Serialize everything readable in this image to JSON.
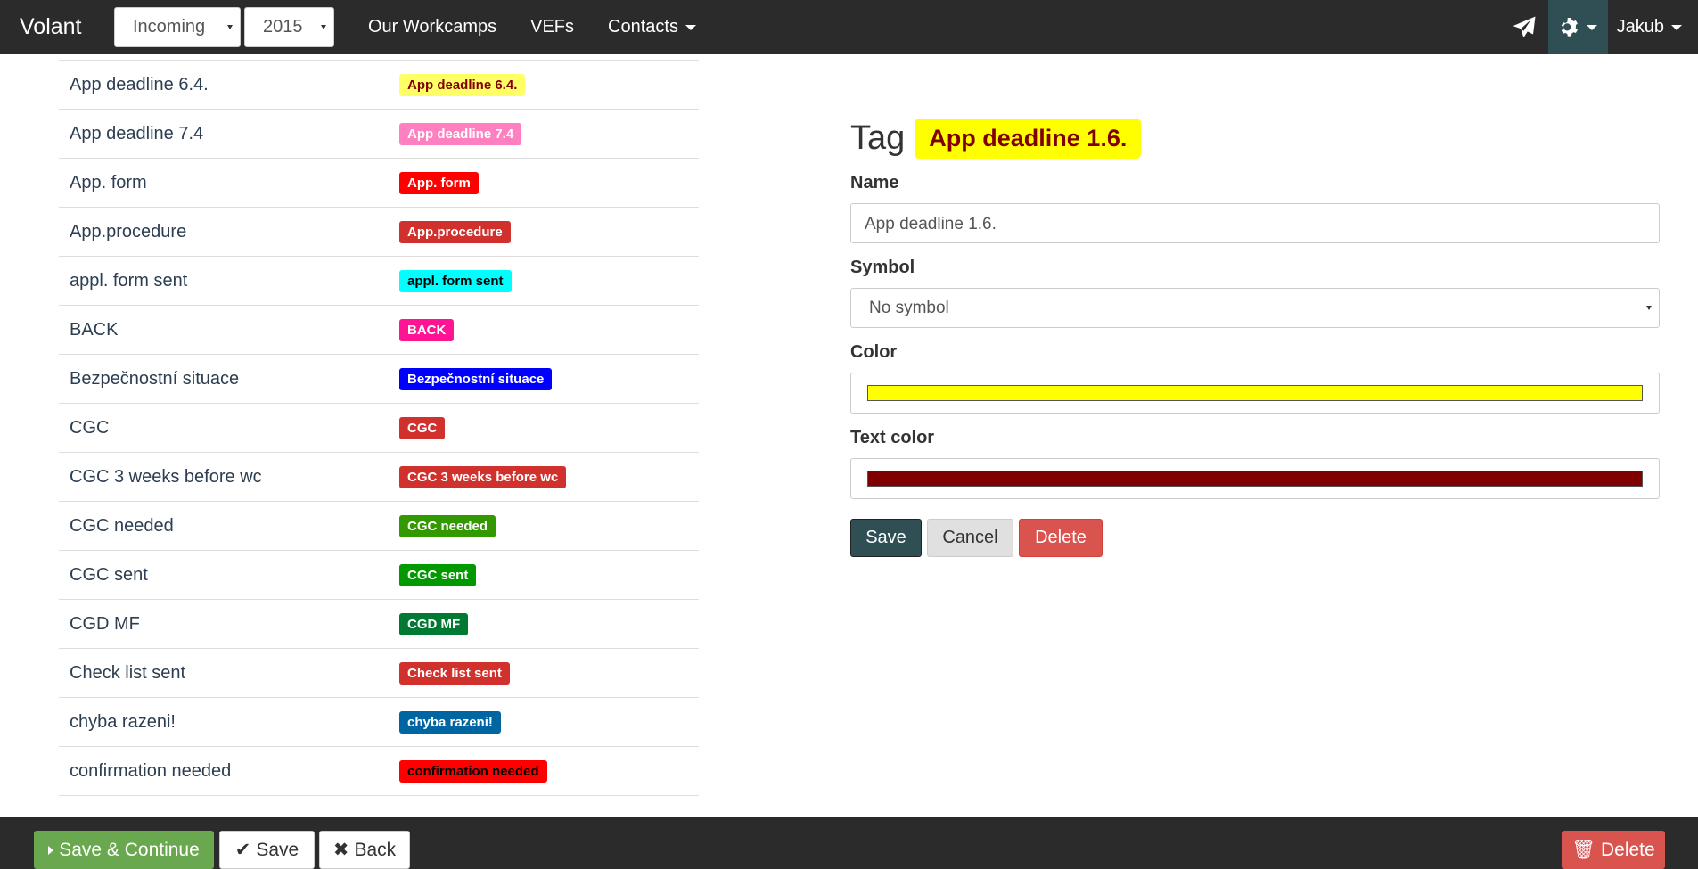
{
  "navbar": {
    "brand": "Volant",
    "direction_select": "Incoming",
    "year_select": "2015",
    "links": [
      "Our Workcamps",
      "VEFs",
      "Contacts"
    ],
    "user": "Jakub"
  },
  "tags": [
    {
      "name": "App deadline 6.4.",
      "badge": "App deadline 6.4.",
      "bg": "#ffff66",
      "fg": "#800000"
    },
    {
      "name": "App deadline 7.4",
      "badge": "App deadline 7.4",
      "bg": "#ff80c0",
      "fg": "#ffffff"
    },
    {
      "name": "App. form",
      "badge": "App. form",
      "bg": "#ff0000",
      "fg": "#ffffff"
    },
    {
      "name": "App.procedure",
      "badge": "App.procedure",
      "bg": "#d0312d",
      "fg": "#ffffff"
    },
    {
      "name": "appl. form sent",
      "badge": "appl. form sent",
      "bg": "#00ffff",
      "fg": "#000000"
    },
    {
      "name": "BACK",
      "badge": "BACK",
      "bg": "#ff1493",
      "fg": "#ffffff"
    },
    {
      "name": "Bezpečnostní situace",
      "badge": "Bezpečnostní situace",
      "bg": "#0000ff",
      "fg": "#ffffff"
    },
    {
      "name": "CGC",
      "badge": "CGC",
      "bg": "#d0312d",
      "fg": "#ffffff"
    },
    {
      "name": "CGC 3 weeks before wc",
      "badge": "CGC 3 weeks before wc",
      "bg": "#d0312d",
      "fg": "#ffffff"
    },
    {
      "name": "CGC needed",
      "badge": "CGC needed",
      "bg": "#339900",
      "fg": "#ffffff"
    },
    {
      "name": "CGC sent",
      "badge": "CGC sent",
      "bg": "#009900",
      "fg": "#ffffff"
    },
    {
      "name": "CGD MF",
      "badge": "CGD MF",
      "bg": "#007a33",
      "fg": "#ffffff"
    },
    {
      "name": "Check list sent",
      "badge": "Check list sent",
      "bg": "#d0312d",
      "fg": "#ffffff"
    },
    {
      "name": "chyba razeni!",
      "badge": "chyba razeni!",
      "bg": "#0066a1",
      "fg": "#ffffff"
    },
    {
      "name": "confirmation needed",
      "badge": "confirmation needed",
      "bg": "#ff0000",
      "fg": "#000000"
    }
  ],
  "form": {
    "title": "Tag",
    "preview": "App deadline 1.6.",
    "name_label": "Name",
    "name_value": "App deadline 1.6.",
    "symbol_label": "Symbol",
    "symbol_value": "No symbol",
    "color_label": "Color",
    "color_value": "#ffff00",
    "text_color_label": "Text color",
    "text_color_value": "#800000",
    "save": "Save",
    "cancel": "Cancel",
    "delete": "Delete"
  },
  "footer": {
    "save_continue": "Save & Continue",
    "save": "Save",
    "back": "Back",
    "delete": "Delete"
  }
}
